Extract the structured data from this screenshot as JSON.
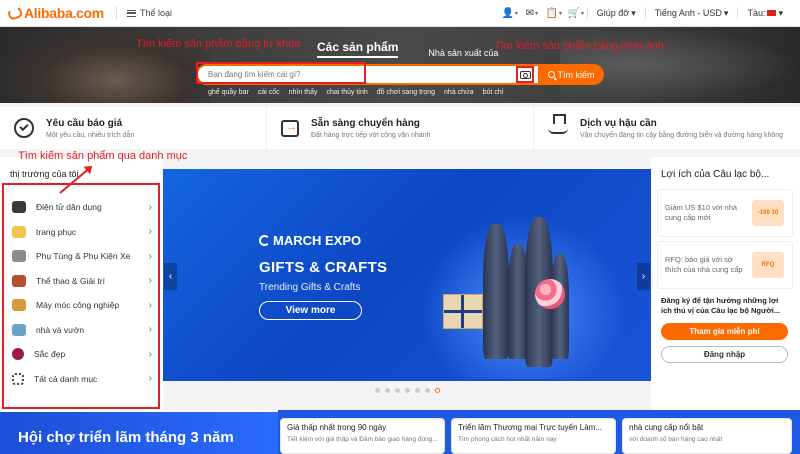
{
  "header": {
    "logo_text": "Alibaba.com",
    "category_menu": "Thể loại",
    "help": "Giúp đỡ",
    "language": "Tiếng Anh - USD",
    "ship_to": "Tàu:"
  },
  "search": {
    "tabs": [
      "Các sản phẩm",
      "Nhà sản xuất của"
    ],
    "placeholder": "Bạn đang tìm kiếm cái gì?",
    "button_label": "Tìm kiếm",
    "keywords": [
      "ghế quầy bar",
      "cái cốc",
      "nhìn thấy",
      "chai thủy tinh",
      "đồ chơi sang trọng",
      "nhà chứa",
      "bút chì"
    ]
  },
  "annotations": {
    "keyword_search": "Tìm kiếm sản phẩm bằng từ khóa",
    "image_search": "Tìm kiếm sản phẩm bằng hình ảnh",
    "category_search": "Tìm kiếm sản phẩm qua danh mục"
  },
  "services": [
    {
      "title": "Yêu cầu báo giá",
      "desc": "Một yêu cầu, nhiều trích dẫn",
      "icon": "checkmark-circle-icon"
    },
    {
      "title": "Sẵn sàng chuyển hàng",
      "desc": "Đặt hàng trực tiếp với công văn nhanh",
      "icon": "ready-to-ship-icon"
    },
    {
      "title": "Dịch vụ hậu cần",
      "desc": "Vận chuyển đáng tin cậy bằng đường biển và đường hàng không",
      "icon": "cargo-ship-icon"
    }
  ],
  "categories": {
    "title": "thị trường của tôi",
    "items": [
      {
        "label": "Điện tử dân dụng",
        "color": "#3a3a3a"
      },
      {
        "label": "trang phục",
        "color": "#f2c14e"
      },
      {
        "label": "Phụ Tùng & Phụ Kiện Xe",
        "color": "#8a8a8a"
      },
      {
        "label": "Thể thao & Giải trí",
        "color": "#b5502f"
      },
      {
        "label": "Máy móc công nghiệp",
        "color": "#d79a3a"
      },
      {
        "label": "nhà và vườn",
        "color": "#6aa3c8"
      },
      {
        "label": "Sắc đẹp",
        "color": "#9b1c3c"
      },
      {
        "label": "Tất cả danh mục",
        "color": "#ffffff"
      }
    ]
  },
  "banner": {
    "brand": "MARCH EXPO",
    "title": "GIFTS & CRAFTS",
    "subtitle": "Trending Gifts & Crafts",
    "button_label": "View more",
    "slide_count": 7,
    "active_slide": 7
  },
  "club": {
    "title": "Lợi ích của Câu lạc bộ...",
    "cards": [
      {
        "text": "Giảm US $10 với nhà cung cấp mới",
        "thumb": "-100 10"
      },
      {
        "text": "RFQ: báo giá với sở thích của nhà cung cấp",
        "thumb": "RFQ"
      }
    ],
    "note": "Đăng ký để tận hưởng những lợi ích thú vị của Câu lạc bộ Người...",
    "join_label": "Tham gia miễn phí",
    "login_label": "Đăng nhập"
  },
  "bottom": {
    "fair_title": "Hội chợ triển lãm tháng 3 năm",
    "deals": [
      {
        "title": "Giá thấp nhất trong 90 ngày",
        "desc": "Tiết kiệm với giá thấp và Đảm bảo giao hàng đúng..."
      },
      {
        "title": "Triển lãm Thương mại Trực tuyến Làm...",
        "desc": "Tìm phong cách hot nhất năm nay"
      },
      {
        "title": "nhà cung cấp nổi bật",
        "desc": "với doanh số bán hàng cao nhất"
      }
    ]
  },
  "colors": {
    "brand": "#ff6a00",
    "annotation": "#e31e24",
    "banner": "#1565e0"
  }
}
